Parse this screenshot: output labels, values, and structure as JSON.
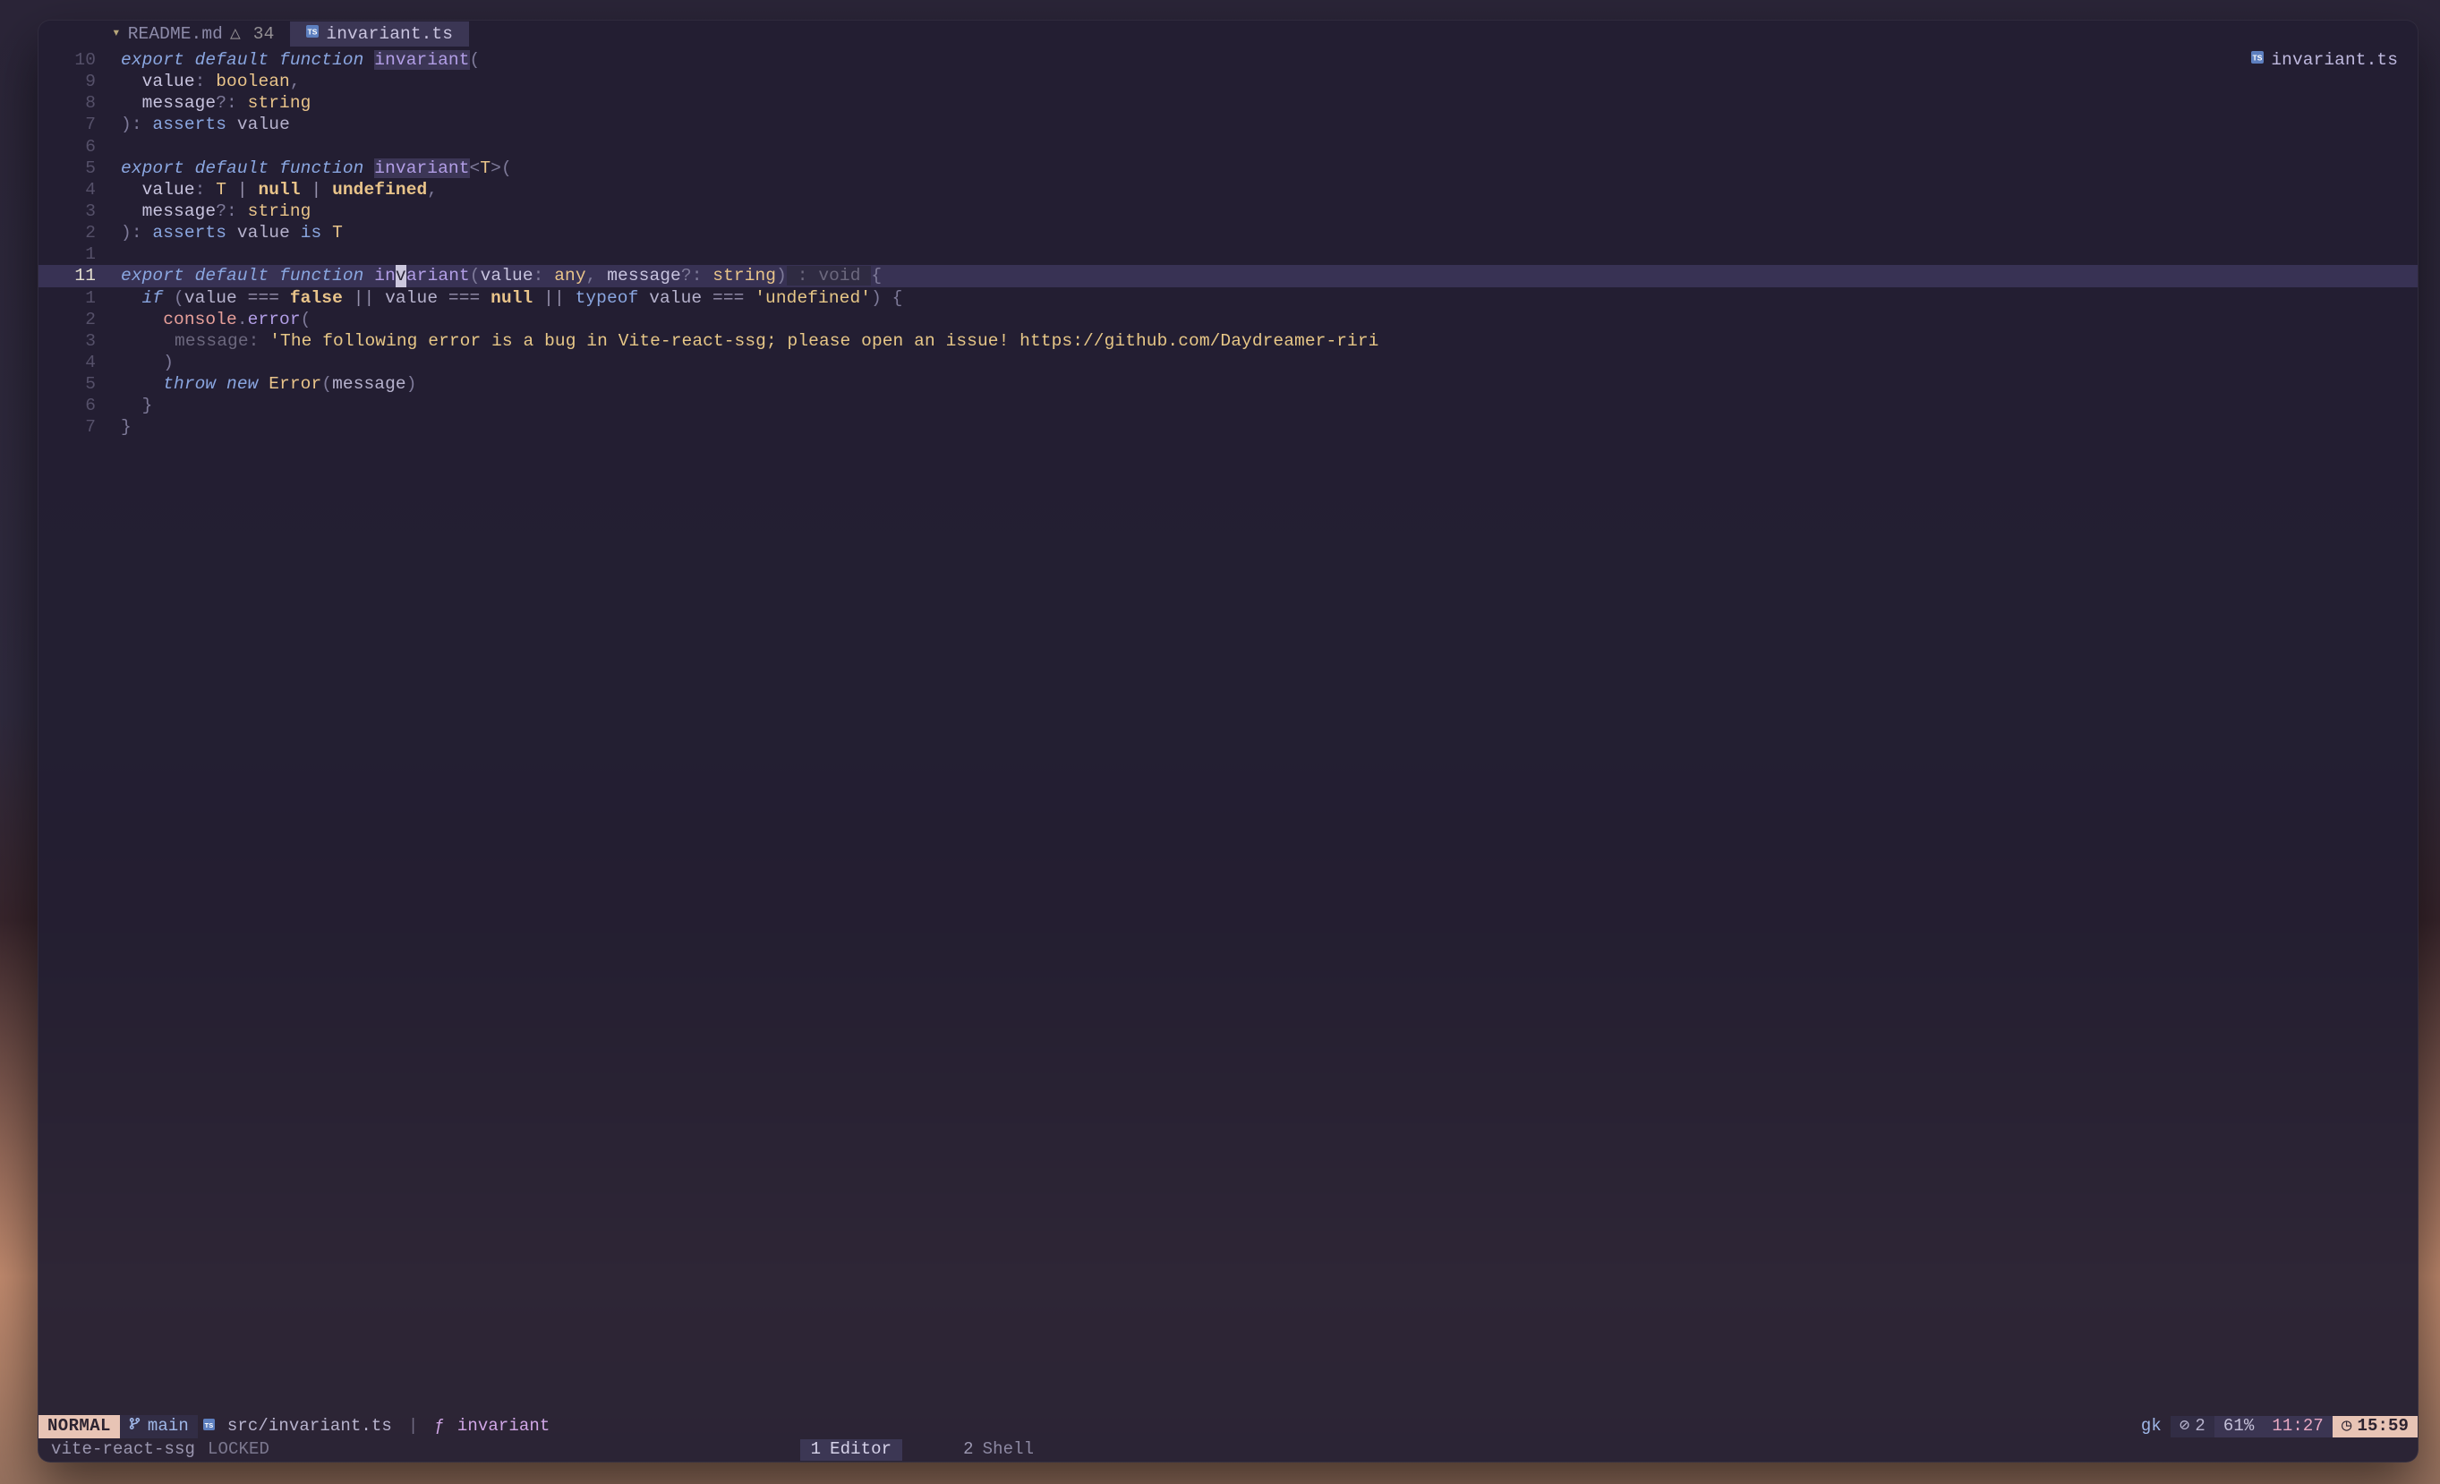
{
  "tabs": [
    {
      "icon": "md-file-icon",
      "label": "README.md",
      "modified_icon": "△",
      "badge": "34"
    },
    {
      "icon": "ts-file-icon",
      "label": "invariant.ts"
    }
  ],
  "winbar": {
    "icon": "ts-file-icon",
    "label": "invariant.ts"
  },
  "gutter": [
    "10",
    "9",
    "8",
    "7",
    "6",
    "5",
    "4",
    "3",
    "2",
    "1",
    "11",
    "1",
    "2",
    "3",
    "4",
    "5",
    "6",
    "7"
  ],
  "code": {
    "l0": {
      "kw_export": "export",
      "kw_default": "default",
      "kw_function": "function",
      "fn": "invariant",
      "open": "("
    },
    "l1": {
      "p": "value",
      "colon": ": ",
      "t": "boolean",
      "comma": ","
    },
    "l2": {
      "p": "message",
      "q": "?",
      "colon": ": ",
      "t": "string"
    },
    "l3": {
      "close": ")",
      "colon": ": ",
      "kw": "asserts",
      "v": "value"
    },
    "l5": {
      "kw_export": "export",
      "kw_default": "default",
      "kw_function": "function",
      "fn": "invariant",
      "gopen": "<",
      "T": "T",
      "gclose": ">",
      "open": "("
    },
    "l6": {
      "p": "value",
      "colon": ": ",
      "T": "T",
      "pipe": " | ",
      "null": "null",
      "pipe2": " | ",
      "undef": "undefined",
      "comma": ","
    },
    "l7": {
      "p": "message",
      "q": "?",
      "colon": ": ",
      "t": "string"
    },
    "l8": {
      "close": ")",
      "colon": ": ",
      "kw": "asserts",
      "v": "value",
      "is": "is",
      "T": "T"
    },
    "l10": {
      "kw_export": "export",
      "kw_default": "default",
      "kw_function": "function",
      "fn_pre": "in",
      "fn_cursor": "v",
      "fn_post": "ariant",
      "open": "(",
      "p1": "value",
      "c1": ": ",
      "t1": "any",
      "comma": ", ",
      "p2": "message",
      "q": "?",
      "c2": ": ",
      "t2": "string",
      "close": ")",
      "hint": " : void ",
      "brace": "{"
    },
    "l11": {
      "kw_if": "if",
      "sp": " ",
      "open": "(",
      "v1": "value",
      "eq1": " === ",
      "false": "false",
      "or1": " || ",
      "v2": "value",
      "eq2": " === ",
      "null": "null",
      "or2": " || ",
      "typeof": "typeof",
      "sp2": " ",
      "v3": "value",
      "eq3": " === ",
      "str": "'undefined'",
      "close": ")",
      "brace": " {"
    },
    "l12": {
      "obj": "console",
      "dot": ".",
      "m": "error",
      "open": "("
    },
    "l13": {
      "hint": "message: ",
      "str": "'The following error is a bug in Vite-react-ssg; please open an issue! https://github.com/Daydreamer-riri"
    },
    "l14": {
      "close": ")"
    },
    "l15": {
      "throw": "throw",
      "new": "new",
      "Err": "Error",
      "open": "(",
      "arg": "message",
      "close": ")"
    },
    "l16": {
      "brace": "}"
    },
    "l17": {
      "brace": "}"
    }
  },
  "statusline": {
    "mode": "NORMAL",
    "branch": "main",
    "path": "src/invariant.ts",
    "sep": "|",
    "fn_icon": "ƒ",
    "fn": "invariant",
    "gk": "gk",
    "diag_icon": "⊘",
    "diag_count": "2",
    "percent": "61%",
    "position": "11:27",
    "clock_icon": "◷",
    "time": "15:59"
  },
  "mux": {
    "session": "vite-react-ssg",
    "state": "LOCKED",
    "windows": [
      {
        "index": "1",
        "name": "Editor",
        "active": true
      },
      {
        "index": "2",
        "name": "Shell",
        "active": false
      }
    ]
  }
}
